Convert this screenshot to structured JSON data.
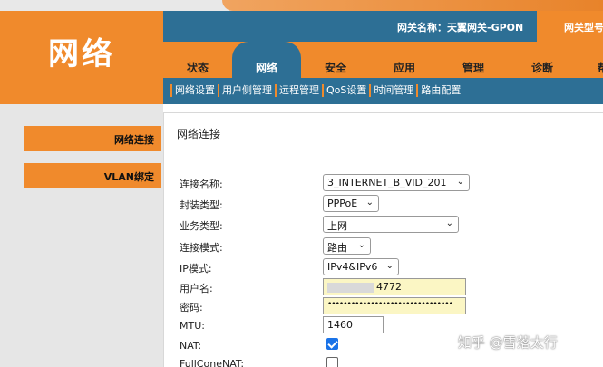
{
  "header": {
    "logo": "网络",
    "gateway_name": "网关名称：天翼网关-GPON",
    "gateway_type": "网关型号"
  },
  "tabs": [
    {
      "label": "状态"
    },
    {
      "label": "网络"
    },
    {
      "label": "安全"
    },
    {
      "label": "应用"
    },
    {
      "label": "管理"
    },
    {
      "label": "诊断"
    },
    {
      "label": "帮"
    }
  ],
  "subnav": [
    {
      "label": "网络设置"
    },
    {
      "label": "用户侧管理"
    },
    {
      "label": "远程管理"
    },
    {
      "label": "QoS设置"
    },
    {
      "label": "时间管理"
    },
    {
      "label": "路由配置"
    }
  ],
  "sidebar": {
    "items": [
      {
        "label": "网络连接"
      },
      {
        "label": "VLAN绑定"
      }
    ]
  },
  "content": {
    "title": "网络连接",
    "connection_name_label": "连接名称:",
    "connection_name_value": "3_INTERNET_B_VID_201",
    "encap_label": "封装类型:",
    "encap_value": "PPPoE",
    "service_label": "业务类型:",
    "service_value": "上网",
    "mode_label": "连接模式:",
    "mode_value": "路由",
    "ip_mode_label": "IP模式:",
    "ip_mode_value": "IPv4&IPv6",
    "username_label": "用户名:",
    "username_value": "4772",
    "password_label": "密码:",
    "password_value": "••••••••••••••••••••••••••••••••",
    "mtu_label": "MTU:",
    "mtu_value": "1460",
    "nat_label": "NAT:",
    "nat_checked": true,
    "fullcone_label": "FullConeNAT:",
    "fullcone_checked": false
  },
  "watermark": "知乎 @雪落太行",
  "colors": {
    "accent": "#f08a2c",
    "nav_blue": "#2d6f95"
  }
}
